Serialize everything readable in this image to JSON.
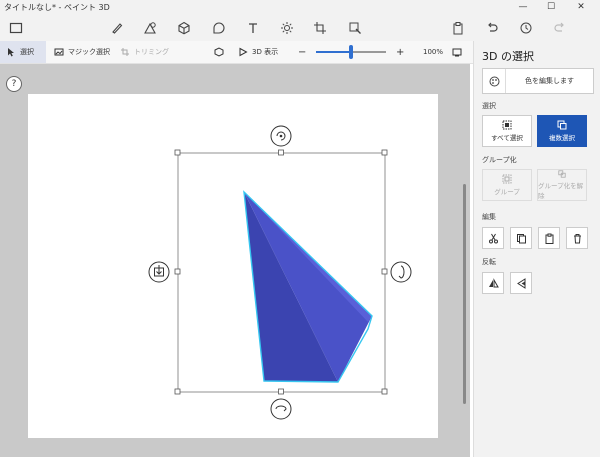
{
  "window": {
    "title": "タイトルなし* - ペイント 3D"
  },
  "ribbon": {
    "tools": [
      "menu-icon",
      "brushes-icon",
      "2d-shapes-icon",
      "3d-shapes-icon",
      "stickers-icon",
      "text-icon",
      "effects-icon",
      "canvas-icon",
      "magic-select-icon",
      "paste-icon",
      "undo-icon",
      "history-icon",
      "redo-icon"
    ]
  },
  "subbar": {
    "select_label": "選択",
    "magic_select_label": "マジック選択",
    "crop_label": "トリミング",
    "view3d_label": "3D 表示",
    "zoom_minus": "−",
    "zoom_plus": "+",
    "zoom_level": "100%",
    "zoom_fraction": 0.5
  },
  "canvas": {
    "help_label": "?",
    "shape_colors": {
      "dark": "#3b44b0",
      "mid": "#4a52c8",
      "light": "#5a60d8",
      "outline": "#36c6f0"
    }
  },
  "panel": {
    "title": "3D の選択",
    "edit_color_label": "色を編集します",
    "select_section": "選択",
    "select_all_label": "すべて選択",
    "multi_select_label": "複数選択",
    "group_section": "グループ化",
    "group_label": "グループ",
    "ungroup_label": "グループ化を解除",
    "edit_section": "編集",
    "flip_section": "反転"
  },
  "colors": {
    "accent": "#1e56b5",
    "canvas_bg": "#c9c9c9",
    "panel_bg": "#f2f2f2"
  }
}
